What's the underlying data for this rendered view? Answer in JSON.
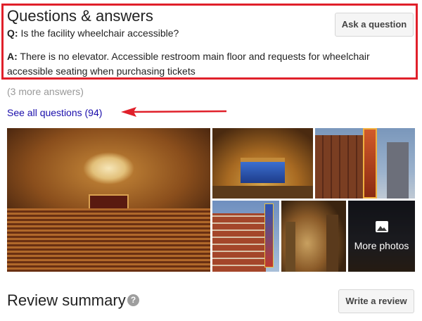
{
  "qa": {
    "title": "Questions & answers",
    "ask_button": "Ask a question",
    "question_prefix": "Q:",
    "question_text": " Is the facility wheelchair accessible?",
    "answer_prefix": "A:",
    "answer_text": " There is no elevator. Accessible restroom main floor and requests for wheelchair accessible seating when purchasing tickets",
    "more_answers": "(3 more answers)",
    "see_all": "See all questions (94)"
  },
  "annotation": {
    "highlight_color": "#e0202a",
    "arrow_color": "#e0202a"
  },
  "photos": {
    "more_label": "More photos",
    "more_icon": "photo-icon"
  },
  "review": {
    "title": "Review summary",
    "help_icon": "?",
    "write_button": "Write a review"
  },
  "colors": {
    "link": "#1a0dab",
    "muted": "#999999"
  }
}
